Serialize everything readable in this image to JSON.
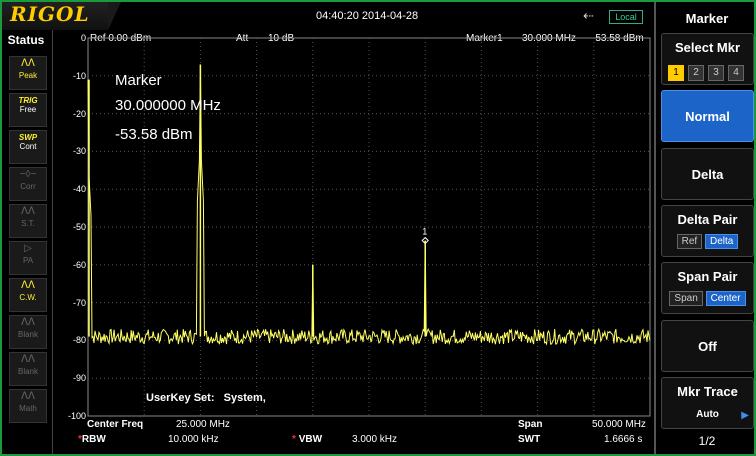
{
  "header": {
    "brand": "RIGOL",
    "datetime": "04:40:20 2014-04-28",
    "usb_icon": "usb-icon",
    "local_badge": "Local"
  },
  "status_panel": {
    "title": "Status",
    "items": [
      {
        "icon": "peak-icon",
        "glyph": "ᐱᐱ",
        "label": "Peak",
        "state": "on"
      },
      {
        "icon": "",
        "glyph": "",
        "label": "TRIG",
        "sub": "Free",
        "state": "on"
      },
      {
        "icon": "",
        "glyph": "",
        "label": "SWP",
        "sub": "Cont",
        "state": "on"
      },
      {
        "icon": "corr-icon",
        "glyph": "~◊~",
        "label": "Corr",
        "state": "off"
      },
      {
        "icon": "st-icon",
        "glyph": "ᐱᐱ",
        "label": "S.T.",
        "state": "off"
      },
      {
        "icon": "pa-icon",
        "glyph": "▷",
        "label": "PA",
        "state": "off"
      },
      {
        "icon": "cw-icon",
        "glyph": "ᐱᐱ",
        "label": "C.W.",
        "state": "on"
      },
      {
        "icon": "blank-icon",
        "glyph": "ᐱᐱ",
        "label": "Blank",
        "state": "off"
      },
      {
        "icon": "blank-icon",
        "glyph": "ᐱᐱ",
        "label": "Blank",
        "state": "off"
      },
      {
        "icon": "math-icon",
        "glyph": "ᐱᐱ",
        "label": "Math",
        "state": "off"
      }
    ]
  },
  "plot": {
    "ref": "Ref  0.00 dBm",
    "att_label": "Att",
    "att_value": "10 dB",
    "marker_label": "Marker1",
    "marker_freq": "30.000 MHz",
    "marker_amp": "-53.58 dBm",
    "y_labels": [
      "0",
      "-10",
      "-20",
      "-30",
      "-40",
      "-50",
      "-60",
      "-70",
      "-80",
      "-90",
      "-100"
    ],
    "overlay": {
      "title": "Marker",
      "freq": "30.000000 MHz",
      "amp": "-53.58 dBm"
    },
    "marker_tag": "1",
    "userkey_label": "UserKey Set:",
    "userkey_value": "System,",
    "bottom": {
      "center_label": "Center Freq",
      "center_value": "25.000 MHz",
      "span_label": "Span",
      "span_value": "50.000 MHz",
      "rbw_label": "RBW",
      "rbw_value": "10.000 kHz",
      "vbw_label": "VBW",
      "vbw_value": "3.000 kHz",
      "swt_label": "SWT",
      "swt_value": "1.6666 s",
      "star": "*"
    },
    "trace_color": "#ffff66",
    "grid_color": "#555555"
  },
  "chart_data": {
    "type": "line",
    "xlim": [
      0,
      50
    ],
    "ylim": [
      -100,
      0
    ],
    "noise_floor": -79,
    "peaks": [
      {
        "x": 0,
        "y": -11
      },
      {
        "x": 10,
        "y": -7
      },
      {
        "x": 20,
        "y": -60
      },
      {
        "x": 30,
        "y": -53.58
      }
    ],
    "marker": {
      "x": 30,
      "y": -53.58
    }
  },
  "menu": {
    "title": "Marker",
    "select_label": "Select Mkr",
    "mkr_numbers": [
      "1",
      "2",
      "3",
      "4"
    ],
    "normal": "Normal",
    "delta": "Delta",
    "delta_pair": "Delta Pair",
    "delta_pair_opts": [
      "Ref",
      "Delta"
    ],
    "span_pair": "Span Pair",
    "span_pair_opts": [
      "Span",
      "Center"
    ],
    "off": "Off",
    "mkr_trace": "Mkr Trace",
    "mkr_trace_value": "Auto",
    "page": "1/2"
  }
}
